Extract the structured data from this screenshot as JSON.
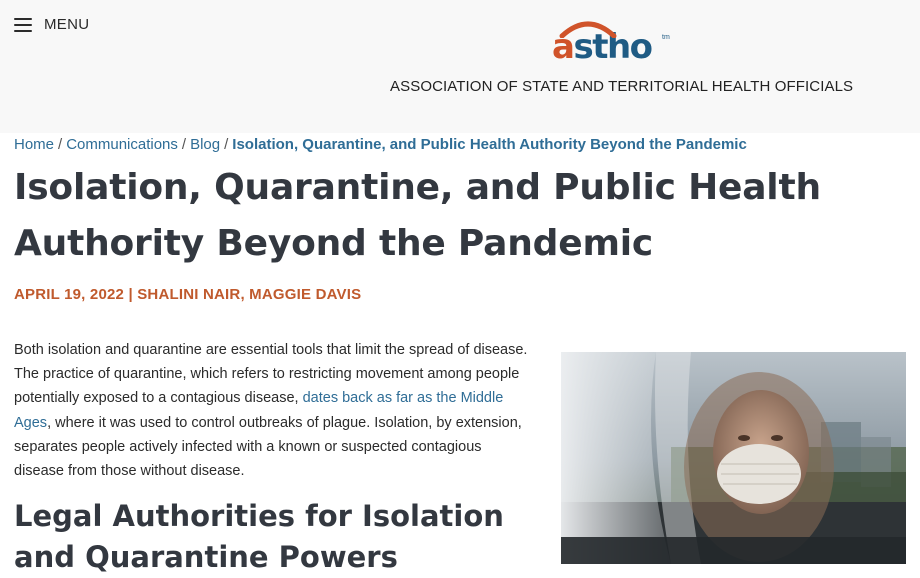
{
  "header": {
    "menu_label": "MENU",
    "logo": {
      "letter_a": "a",
      "letters_sth": "stho",
      "tm": "tm"
    },
    "org_name": "ASSOCIATION OF STATE AND TERRITORIAL HEALTH OFFICIALS"
  },
  "breadcrumb": {
    "items": [
      "Home",
      "Communications",
      "Blog"
    ],
    "separator": "/",
    "current": "Isolation, Quarantine, and Public Health Authority Beyond the Pandemic"
  },
  "article": {
    "title": "Isolation, Quarantine, and Public Health Authority Beyond the Pandemic",
    "meta": "APRIL 19, 2022 | SHALINI NAIR, MAGGIE DAVIS",
    "paragraph": {
      "part1": "Both isolation and quarantine are essential tools that limit the spread of disease. The practice of quarantine, which refers to restricting movement among people potentially exposed to a contagious disease, ",
      "link_text": "dates back as far as the Middle Ages",
      "part2": ", where it was used to control outbreaks of plague. Isolation, by extension, separates people actively infected with a known or suspected contagious disease from those without disease."
    },
    "subheading": "Legal Authorities for Isolation and Quarantine Powers"
  },
  "colors": {
    "logo_orange": "#d0532a",
    "logo_blue": "#1f5b84",
    "link": "#2f6d96",
    "meta": "#c05a2d",
    "heading": "#333840"
  },
  "icons": {
    "menu": "hamburger-icon"
  }
}
